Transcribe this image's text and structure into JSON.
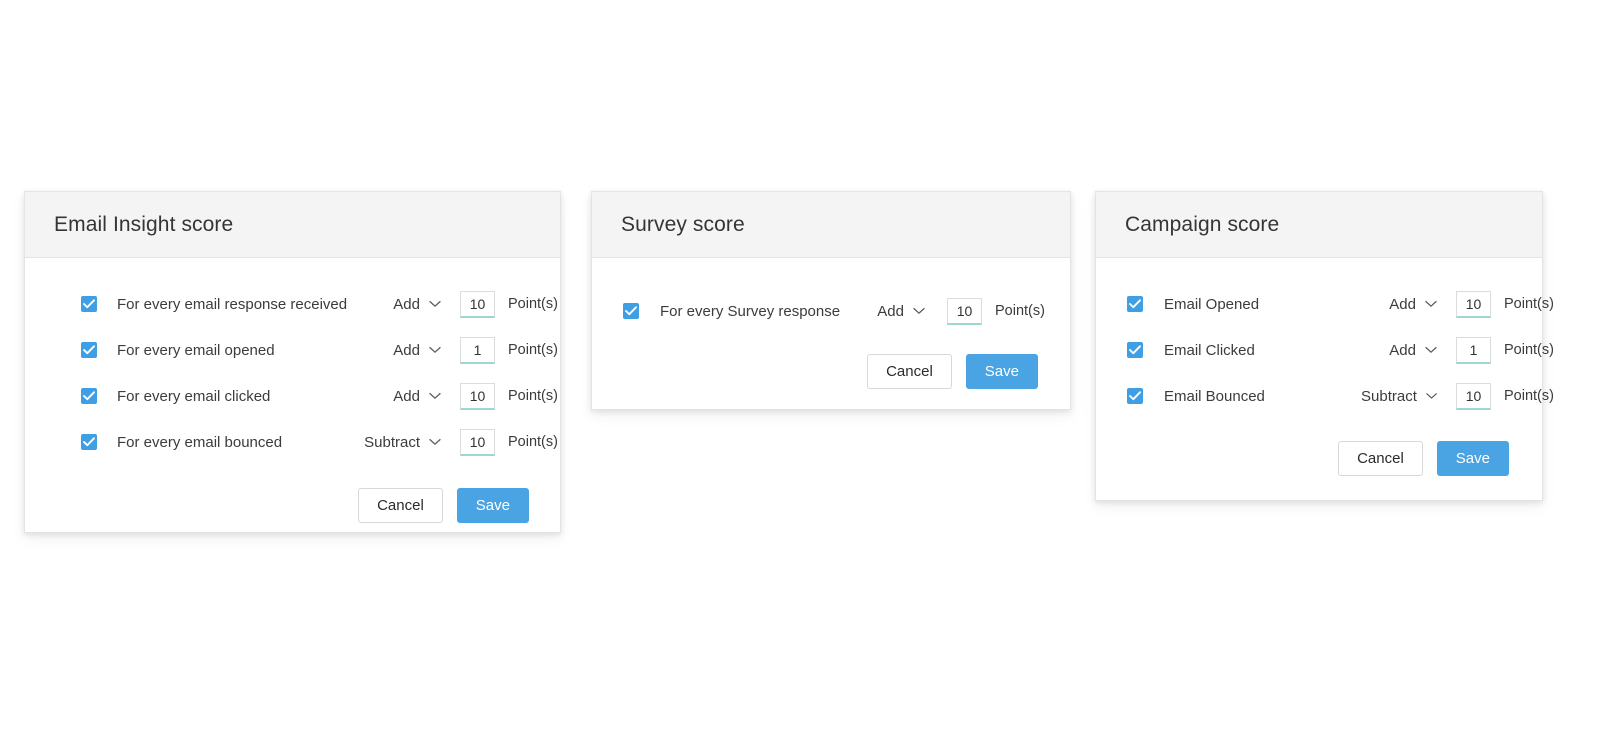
{
  "theme": {
    "accent": "#4aa3e3",
    "checkbox_fill": "#3f9fe5",
    "header_bg": "#f4f4f4",
    "card_border": "#e4e4e4",
    "input_underline": "#9ed6d2",
    "page_bg": "#ffffff",
    "text": "#3c3c3c"
  },
  "common": {
    "points_label": "Point(s)",
    "cancel_label": "Cancel",
    "save_label": "Save",
    "operation_options": [
      "Add",
      "Subtract"
    ],
    "chevron_icon": "chevron-down-icon",
    "check_icon": "check-icon"
  },
  "cards": [
    {
      "id": "email-insight",
      "title": "Email Insight score",
      "rows": [
        {
          "label": "For every email response received",
          "checked": true,
          "operation": "Add",
          "points": "10",
          "points_label": "Point(s)"
        },
        {
          "label": "For every email opened",
          "checked": true,
          "operation": "Add",
          "points": "1",
          "points_label": "Point(s)"
        },
        {
          "label": "For every email clicked",
          "checked": true,
          "operation": "Add",
          "points": "10",
          "points_label": "Point(s)"
        },
        {
          "label": "For every email bounced",
          "checked": true,
          "operation": "Subtract",
          "points": "10",
          "points_label": "Point(s)"
        }
      ],
      "cancel_label": "Cancel",
      "save_label": "Save"
    },
    {
      "id": "survey",
      "title": "Survey score",
      "rows": [
        {
          "label": "For every Survey response",
          "checked": true,
          "operation": "Add",
          "points": "10",
          "points_label": "Point(s)"
        }
      ],
      "cancel_label": "Cancel",
      "save_label": "Save"
    },
    {
      "id": "campaign",
      "title": "Campaign score",
      "rows": [
        {
          "label": "Email Opened",
          "checked": true,
          "operation": "Add",
          "points": "10",
          "points_label": "Point(s)"
        },
        {
          "label": "Email Clicked",
          "checked": true,
          "operation": "Add",
          "points": "1",
          "points_label": "Point(s)"
        },
        {
          "label": "Email Bounced",
          "checked": true,
          "operation": "Subtract",
          "points": "10",
          "points_label": "Point(s)"
        }
      ],
      "cancel_label": "Cancel",
      "save_label": "Save"
    }
  ]
}
